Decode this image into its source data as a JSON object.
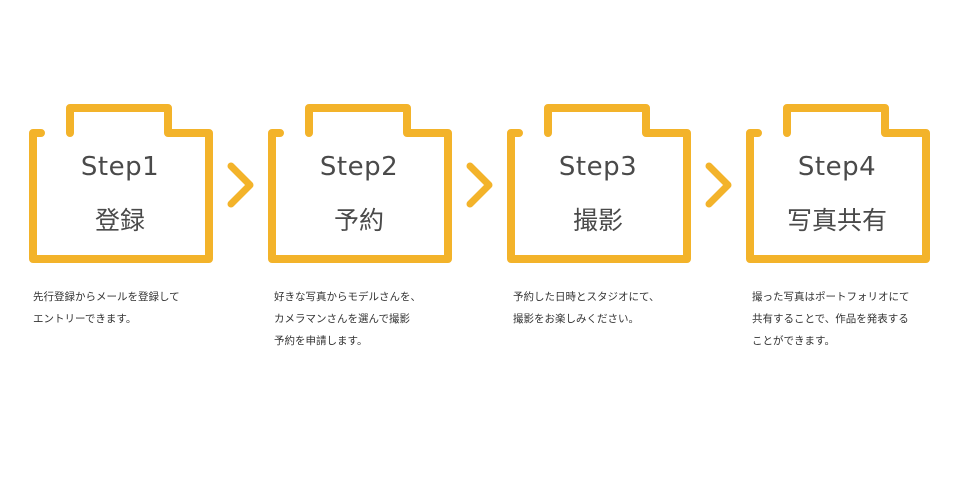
{
  "accent_color": "#f3b32a",
  "steps": [
    {
      "title": "Step1",
      "name": "登録",
      "description": "先行登録からメールを登録して\nエントリーできます。"
    },
    {
      "title": "Step2",
      "name": "予約",
      "description": "好きな写真からモデルさんを、\nカメラマンさんを選んで撮影\n予約を申請します。"
    },
    {
      "title": "Step3",
      "name": "撮影",
      "description": "予約した日時とスタジオにて、\n撮影をお楽しみください。"
    },
    {
      "title": "Step4",
      "name": "写真共有",
      "description": "撮った写真はポートフォリオにて\n共有することで、作品を発表する\nことができます。"
    }
  ],
  "connector_icon": "chevron-right-icon"
}
